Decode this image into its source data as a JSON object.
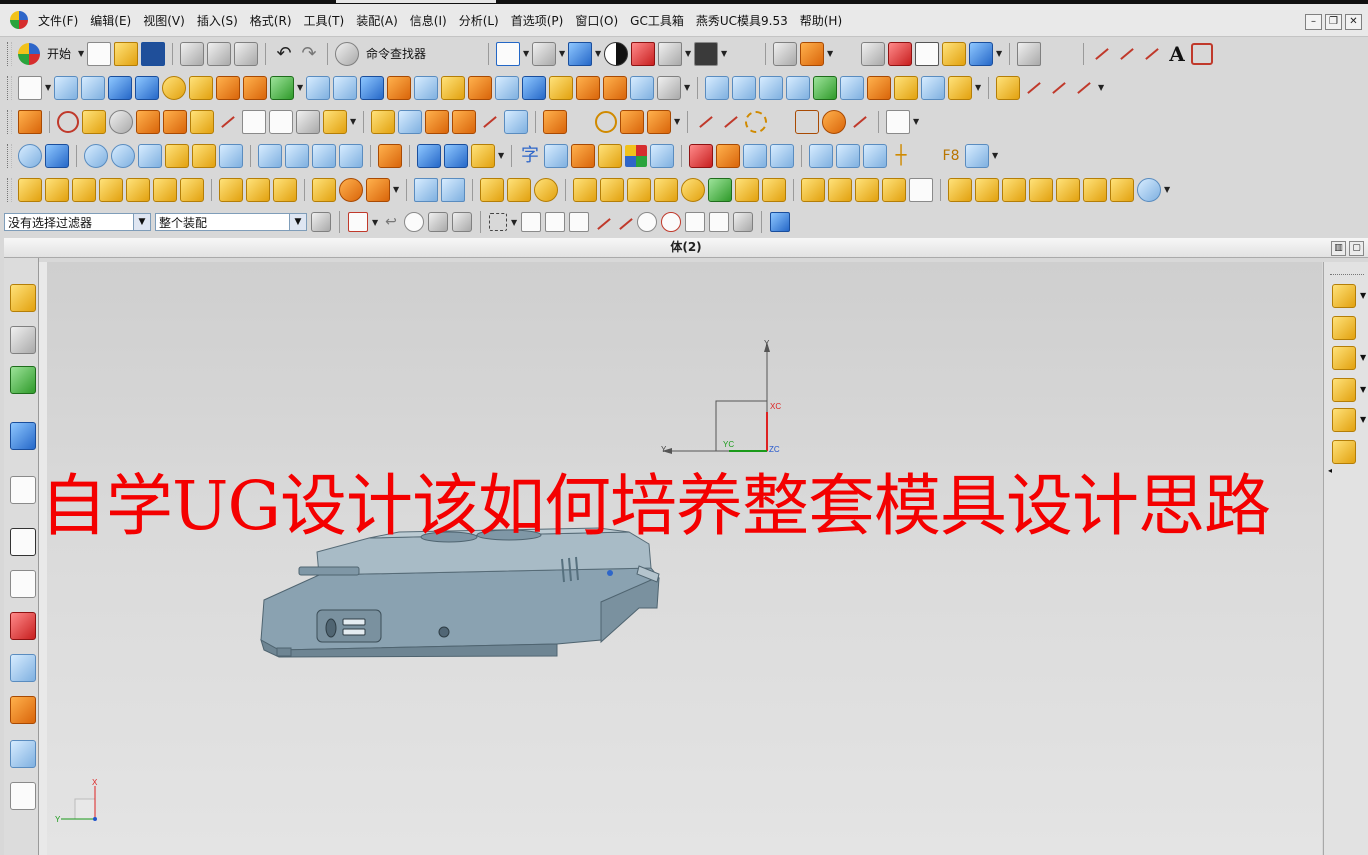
{
  "menu": {
    "items": [
      "文件(F)",
      "编辑(E)",
      "视图(V)",
      "插入(S)",
      "格式(R)",
      "工具(T)",
      "装配(A)",
      "信息(I)",
      "分析(L)",
      "首选项(P)",
      "窗口(O)",
      "GC工具箱",
      "燕秀UC模具9.53",
      "帮助(H)"
    ]
  },
  "toolbar": {
    "start_label": "开始",
    "command_finder_label": "命令查找器",
    "text_tool_label": "A",
    "char_label": "字",
    "f8_label": "F8"
  },
  "filter": {
    "selection_filter": "没有选择过滤器",
    "scope": "整个装配"
  },
  "view": {
    "title": "体(2)",
    "axis_xc": "XC",
    "axis_yc": "YC",
    "axis_zc": "ZC",
    "axis_y": "Y",
    "axis_x": "X"
  },
  "overlay": {
    "caption": "自学UG设计该如何培养整套模具设计思路"
  },
  "colors": {
    "caption": "#f40000",
    "model": "#7f97a6"
  }
}
